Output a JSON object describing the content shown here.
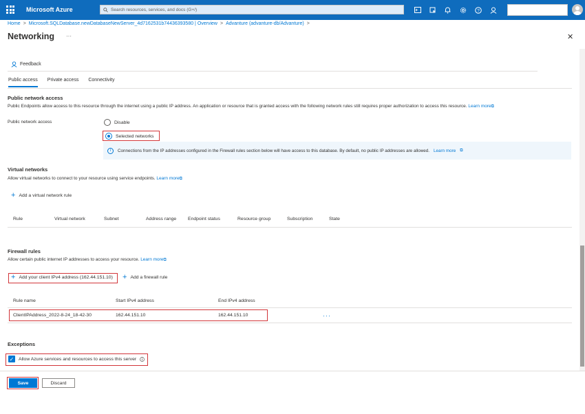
{
  "header": {
    "brand": "Microsoft Azure",
    "search_placeholder": "Search resources, services, and docs (G+/)"
  },
  "breadcrumb": {
    "home": "Home",
    "item1": "Microsoft.SQLDatabase.newDatabaseNewServer_4d7162531b74436393580 | Overview",
    "item2": "Advanture (advanture-db/Advanture)",
    "sep": ">"
  },
  "page": {
    "title": "Networking",
    "more": "···",
    "close": "✕",
    "feedback": "Feedback"
  },
  "tabs": [
    {
      "label": "Public access",
      "active": true
    },
    {
      "label": "Private access",
      "active": false
    },
    {
      "label": "Connectivity",
      "active": false
    }
  ],
  "public_network": {
    "heading": "Public network access",
    "description": "Public Endpoints allow access to this resource through the internet using a public IP address. An application or resource that is granted access with the following network rules still requires proper authorization to access this resource.",
    "learn_more": "Learn more",
    "field_label": "Public network access",
    "option_disable": "Disable",
    "option_selected": "Selected networks",
    "info_text": "Connections from the IP addresses configured in the Firewall rules section below will have access to this database. By default, no public IP addresses are allowed.",
    "info_learn_more": "Learn more"
  },
  "virtual_networks": {
    "heading": "Virtual networks",
    "description": "Allow virtual networks to connect to your resource using service endpoints.",
    "learn_more": "Learn more",
    "add_rule": "Add a virtual network rule",
    "columns": [
      "Rule",
      "Virtual network",
      "Subnet",
      "Address range",
      "Endpoint status",
      "Resource group",
      "Subscription",
      "State"
    ]
  },
  "firewall": {
    "heading": "Firewall rules",
    "description": "Allow certain public internet IP addresses to access your resource.",
    "learn_more": "Learn more",
    "add_client_ip": "Add your client IPv4 address (162.44.151.10)",
    "add_rule": "Add a firewall rule",
    "columns": [
      "Rule name",
      "Start IPv4 address",
      "End IPv4 address"
    ],
    "rows": [
      {
        "name": "ClientIPAddress_2022-8-24_18-42-30",
        "start": "162.44.151.10",
        "end": "162.44.151.10"
      }
    ],
    "more": "···"
  },
  "exceptions": {
    "heading": "Exceptions",
    "allow_azure": "Allow Azure services and resources to access this server"
  },
  "footer": {
    "save": "Save",
    "discard": "Discard"
  },
  "colors": {
    "azure_blue": "#0f6cbd",
    "accent": "#0078d4",
    "highlight": "#d13438"
  }
}
